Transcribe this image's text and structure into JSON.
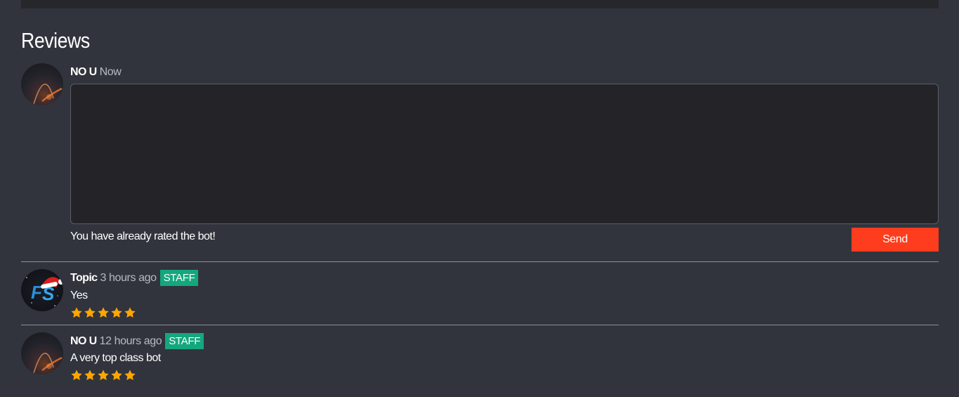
{
  "section": {
    "title": "Reviews"
  },
  "composer": {
    "username": "NO U",
    "time": "Now",
    "textarea_value": "",
    "textarea_placeholder": "",
    "status_message": "You have already rated the bot!",
    "send_label": "Send"
  },
  "reviews": [
    {
      "username": "Topic",
      "time": "3 hours ago",
      "badge": "STAFF",
      "text": "Yes",
      "rating": 5,
      "avatar": "fs-santa-avatar"
    },
    {
      "username": "NO U",
      "time": "12 hours ago",
      "badge": "STAFF",
      "text": "A very top class bot",
      "rating": 5,
      "avatar": "arc-avatar"
    }
  ],
  "colors": {
    "background": "#31343d",
    "send_button": "#fd3d1d",
    "staff_badge": "#14a77d",
    "star": "#ffa600"
  }
}
